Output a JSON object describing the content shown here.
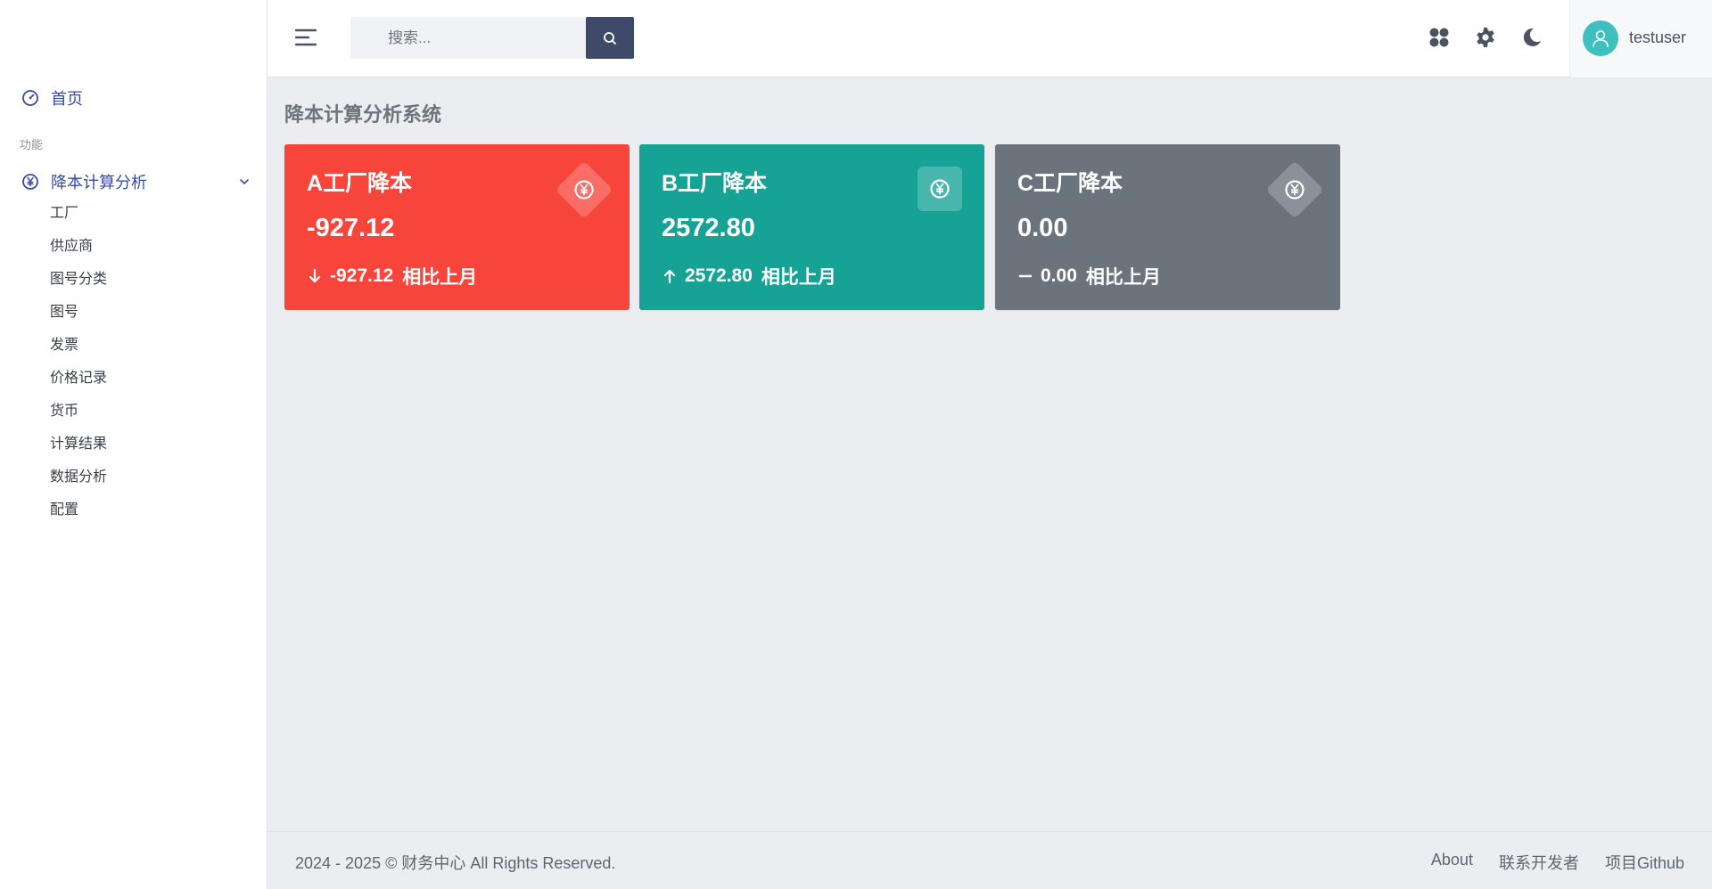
{
  "sidebar": {
    "home_label": "首页",
    "section_label": "功能",
    "group_label": "降本计算分析",
    "items": [
      "工厂",
      "供应商",
      "图号分类",
      "图号",
      "发票",
      "价格记录",
      "货币",
      "计算结果",
      "数据分析",
      "配置"
    ]
  },
  "header": {
    "search_placeholder": "搜索...",
    "username": "testuser"
  },
  "main": {
    "page_title": "降本计算分析系统",
    "cards": [
      {
        "title": "A工厂降本",
        "value": "-927.12",
        "change": "-927.12",
        "note": "相比上月",
        "trend": "down",
        "color": "#f8453b"
      },
      {
        "title": "B工厂降本",
        "value": "2572.80",
        "change": "2572.80",
        "note": "相比上月",
        "trend": "up",
        "color": "#17a296"
      },
      {
        "title": "C工厂降本",
        "value": "0.00",
        "change": "0.00",
        "note": "相比上月",
        "trend": "flat",
        "color": "#6b737d"
      }
    ]
  },
  "footer": {
    "copyright": "2024 - 2025 © 财务中心 All Rights Reserved.",
    "links": [
      "About",
      "联系开发者",
      "项目Github"
    ]
  },
  "colors": {
    "accent": "#3b4aa6",
    "search_button": "#3f4a6b",
    "avatar": "#3fbfc0"
  }
}
